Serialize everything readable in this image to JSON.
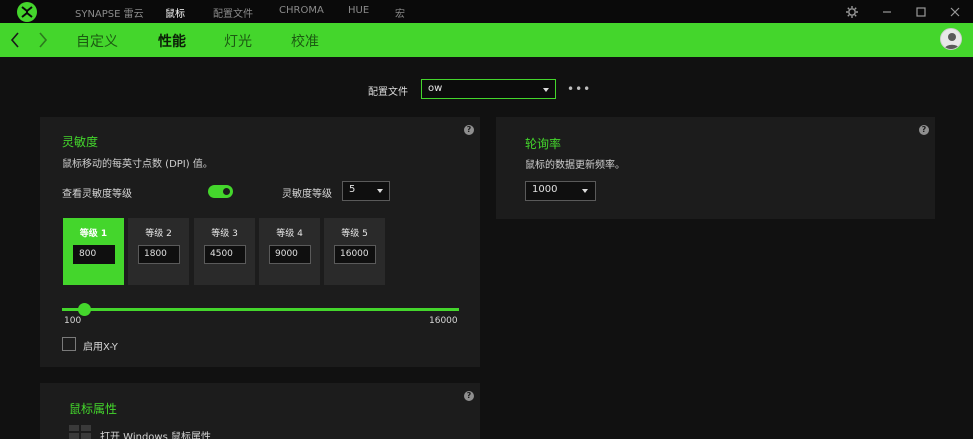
{
  "titlebar": {
    "menu": [
      "SYNAPSE 雷云",
      "鼠标",
      "配置文件",
      "CHROMA",
      "HUE",
      "宏"
    ],
    "active_index": 1
  },
  "nav": {
    "tabs": [
      "自定义",
      "性能",
      "灯光",
      "校准"
    ],
    "active_index": 1
  },
  "profile": {
    "label": "配置文件",
    "value": "ow",
    "more": "•••"
  },
  "sensitivity": {
    "title": "灵敏度",
    "description": "鼠标移动的每英寸点数 (DPI) 值。",
    "toggle_label": "查看灵敏度等级",
    "toggle_on": true,
    "stage_count_label": "灵敏度等级",
    "stage_count": "5",
    "stages": [
      {
        "name": "等级 1",
        "value": "800"
      },
      {
        "name": "等级 2",
        "value": "1800"
      },
      {
        "name": "等级 3",
        "value": "4500"
      },
      {
        "name": "等级 4",
        "value": "9000"
      },
      {
        "name": "等级 5",
        "value": "16000"
      }
    ],
    "active_stage": 0,
    "slider_min": "100",
    "slider_max": "16000",
    "slider_value": 800,
    "xy_label": "启用X-Y"
  },
  "polling": {
    "title": "轮询率",
    "description": "鼠标的数据更新频率。",
    "value": "1000"
  },
  "mouse_props": {
    "title": "鼠标属性",
    "link": "打开 Windows 鼠标属性"
  },
  "help_glyph": "?",
  "colors": {
    "accent": "#44d62c",
    "background": "#111111",
    "panel": "#1c1c1c"
  }
}
